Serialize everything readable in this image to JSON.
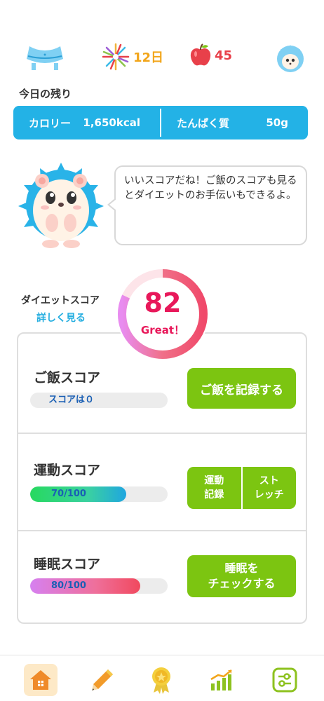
{
  "stats": {
    "streak_days": "12日",
    "apple_count": "45"
  },
  "remaining": {
    "title": "今日の残り",
    "calorie_label": "カロリー",
    "calorie_value": "1,650kcal",
    "protein_label": "たんぱく質",
    "protein_value": "50g"
  },
  "speech": {
    "message": "いいスコアだね！ご飯のスコアも見るとダイエットのお手伝いもできるよ。"
  },
  "diet_score": {
    "label": "ダイエットスコア",
    "detail_link": "詳しく見る",
    "score": "82",
    "score_value": 82,
    "max": 100,
    "rank": "Great！"
  },
  "meal": {
    "title": "ご飯スコア",
    "progress_text": "スコアは０",
    "progress": 0,
    "button": "ご飯を記録する"
  },
  "exercise": {
    "title": "運動スコア",
    "progress_text": "70/100",
    "progress": 0.7,
    "button_record_line1": "運動",
    "button_record_line2": "記録",
    "button_stretch_line1": "スト",
    "button_stretch_line2": "レッチ"
  },
  "sleep": {
    "title": "睡眠スコア",
    "progress_text": "80/100",
    "progress": 0.8,
    "button_line1": "睡眠を",
    "button_line2": "チェックする"
  },
  "nav": {
    "items": [
      "home-icon",
      "pencil-icon",
      "medal-icon",
      "chart-icon",
      "settings-icon"
    ],
    "active": "home-icon"
  },
  "colors": {
    "accent_blue": "#23b2e6",
    "button_green": "#7cc511",
    "score_pink": "#e8185a",
    "streak_orange": "#f2a51a"
  }
}
